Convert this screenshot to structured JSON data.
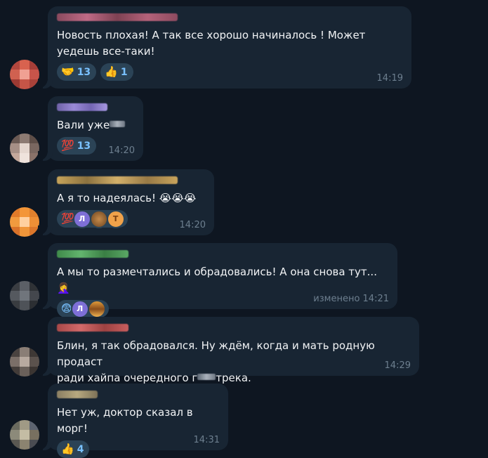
{
  "messages": [
    {
      "text": "Новость плохая! А так все хорошо начиналось ! Может уедешь все-таки!",
      "reactions": [
        {
          "icon": "handshake-emoji",
          "emoji": "🤝",
          "count": "13"
        },
        {
          "icon": "thumbs-up-emoji",
          "emoji": "👍",
          "count": "1"
        }
      ],
      "time": "14:19"
    },
    {
      "text": "Вали уже",
      "reactions": [
        {
          "icon": "hundred-points-emoji",
          "emoji": "💯",
          "count": "13"
        }
      ],
      "time": "14:20"
    },
    {
      "text": "А я то надеялась! 😭😭😭",
      "reactions": [
        {
          "icon": "hundred-points-emoji",
          "emoji": "💯",
          "avatars": [
            "Л",
            "",
            "Т"
          ]
        }
      ],
      "time": "14:20"
    },
    {
      "text": "А мы то размечтались и обрадовались! А она снова тут... 🤦‍♀️",
      "reactions": [
        {
          "icon": "fearful-face-emoji",
          "emoji": "😨",
          "avatars": [
            "Л",
            ""
          ]
        }
      ],
      "time": "изменено 14:21"
    },
    {
      "text_line1": "Блин, я так обрадовался. Ну ждём, когда и мать родную продаст",
      "text_line2_a": "ради хайпа очередного г",
      "text_line2_b": "трека.",
      "time": "14:29"
    },
    {
      "text": "Нет уж, доктор сказал в морг!",
      "reactions": [
        {
          "icon": "thumbs-up-emoji",
          "emoji": "👍",
          "count": "4"
        }
      ],
      "time": "14:31"
    }
  ],
  "colors": {
    "background": "#0e1621",
    "bubble": "#182533",
    "reaction_bg": "#2b4356",
    "reaction_text": "#79c1ff",
    "time": "#6d7f8f"
  }
}
